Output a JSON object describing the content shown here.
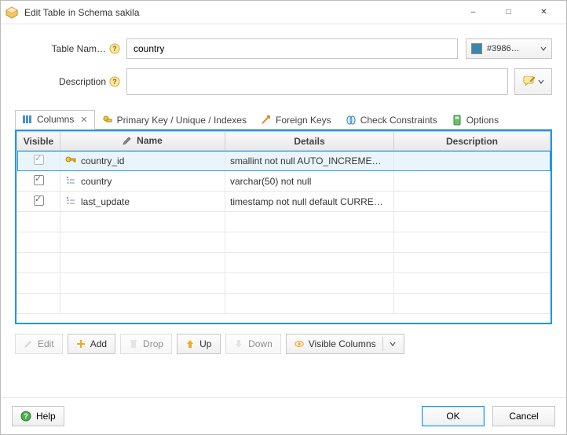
{
  "window": {
    "title": "Edit Table in Schema sakila"
  },
  "form": {
    "nameLabel": "Table Nam…",
    "nameValue": "country",
    "descLabel": "Description",
    "descValue": "",
    "colorLabel": "#3986…",
    "colorHex": "#3986ac"
  },
  "tabs": {
    "items": [
      {
        "label": "Columns",
        "active": true,
        "closable": true
      },
      {
        "label": "Primary Key / Unique / Indexes",
        "active": false
      },
      {
        "label": "Foreign Keys",
        "active": false
      },
      {
        "label": "Check Constraints",
        "active": false
      },
      {
        "label": "Options",
        "active": false
      }
    ]
  },
  "grid": {
    "headers": {
      "visible": "Visible",
      "name": "Name",
      "details": "Details",
      "description": "Description"
    },
    "rows": [
      {
        "visible": true,
        "visibleDisabled": true,
        "icon": "key",
        "name": "country_id",
        "details": "smallint not null AUTO_INCREME…",
        "description": "",
        "selected": true
      },
      {
        "visible": true,
        "visibleDisabled": false,
        "icon": "column",
        "name": "country",
        "details": "varchar(50) not null",
        "description": "",
        "selected": false
      },
      {
        "visible": true,
        "visibleDisabled": false,
        "icon": "column",
        "name": "last_update",
        "details": "timestamp not null default CURRE…",
        "description": "",
        "selected": false
      }
    ],
    "emptyRows": 5
  },
  "toolbar": {
    "edit": "Edit",
    "add": "Add",
    "drop": "Drop",
    "up": "Up",
    "down": "Down",
    "visibleColumns": "Visible Columns"
  },
  "footer": {
    "help": "Help",
    "ok": "OK",
    "cancel": "Cancel"
  }
}
